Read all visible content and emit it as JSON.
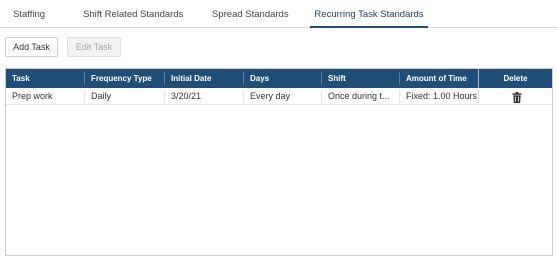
{
  "tabs": [
    {
      "label": "Staffing",
      "active": false
    },
    {
      "label": "Shift Related Standards",
      "active": false
    },
    {
      "label": "Spread Standards",
      "active": false
    },
    {
      "label": "Recurring Task Standards",
      "active": true
    }
  ],
  "toolbar": {
    "add_label": "Add Task",
    "edit_label": "Edit Task",
    "edit_disabled": true
  },
  "table": {
    "header_color": "#1f4e79",
    "columns": [
      "Task",
      "Frequency Type",
      "Initial Date",
      "Days",
      "Shift",
      "Amount of Time",
      "Delete"
    ],
    "rows": [
      {
        "task": "Prep work",
        "frequency_type": "Daily",
        "initial_date": "3/20/21",
        "days": "Every day",
        "shift": "Once during t...",
        "amount_of_time": "Fixed: 1.00 Hours",
        "delete_icon": "trash-icon"
      }
    ]
  }
}
